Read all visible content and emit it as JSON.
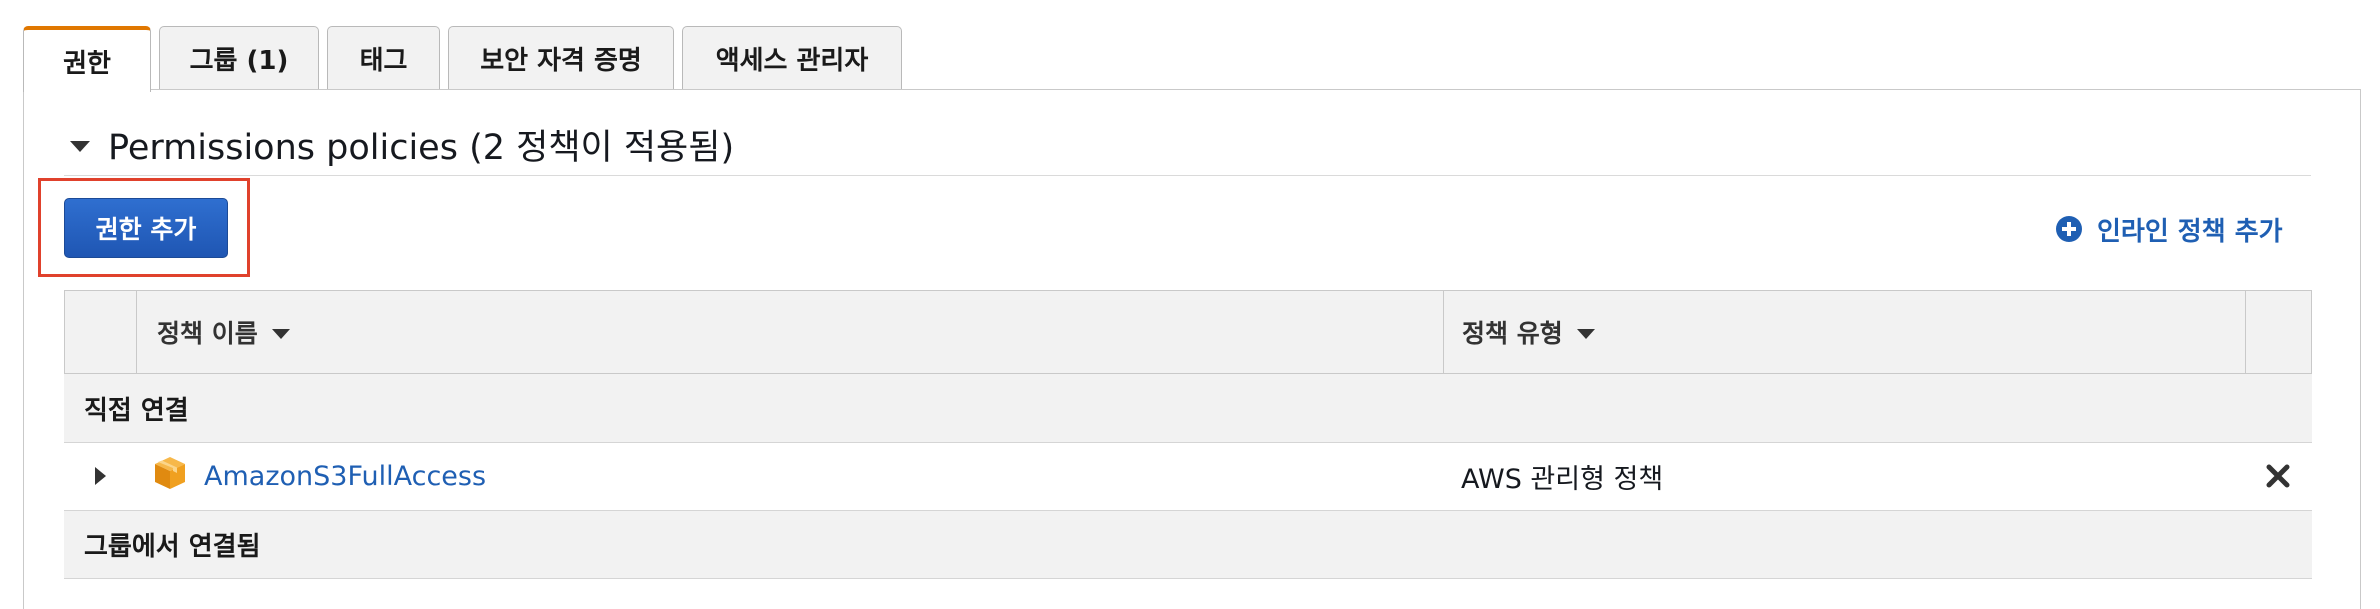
{
  "tabs": [
    {
      "label": "권한",
      "active": true
    },
    {
      "label": "그룹 (1)",
      "active": false
    },
    {
      "label": "태그",
      "active": false
    },
    {
      "label": "보안 자격 증명",
      "active": false
    },
    {
      "label": "액세스 관리자",
      "active": false
    }
  ],
  "section": {
    "title": "Permissions policies (2 정책이 적용됨)",
    "expanded": true
  },
  "actions": {
    "add_permissions_label": "권한 추가",
    "inline_policy_label": "인라인 정책 추가",
    "inline_policy_icon": "plus-circle-icon"
  },
  "table": {
    "columns": [
      "정책 이름",
      "정책 유형"
    ],
    "groups": [
      {
        "label": "직접 연결",
        "rows": [
          {
            "name": "AmazonS3FullAccess",
            "type": "AWS 관리형 정책",
            "icon": "aws-box-icon"
          }
        ]
      },
      {
        "label": "그룹에서 연결됨",
        "rows": []
      }
    ]
  },
  "colors": {
    "accent_tab": "#e07700",
    "button_blue": "#2360c4",
    "link_blue": "#1f5fb3",
    "highlight_red": "#e0412c",
    "aws_orange": "#f0a020"
  }
}
